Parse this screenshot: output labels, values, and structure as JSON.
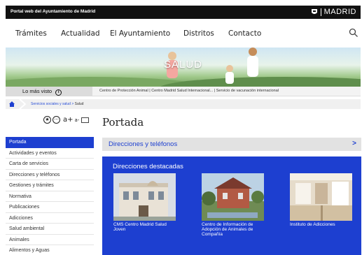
{
  "header": {
    "portal_label": "Portal web del Ayuntamiento de Madrid",
    "brand": "MADRID"
  },
  "nav": {
    "items": [
      "Trámites",
      "Actualidad",
      "El Ayuntamiento",
      "Distritos",
      "Contacto"
    ]
  },
  "hero": {
    "title": "SALUD"
  },
  "most_visited": {
    "label": "Lo más visto",
    "links": "Centro de Protección Animal  |  Centro Madrid Salud Internacional...  |  Servicio de vacunación internacional"
  },
  "breadcrumb": {
    "parent": "Servicios sociales y salud",
    "sep": ">",
    "current": "Salud"
  },
  "tools": {
    "a_plus": "a+",
    "a_minus": "a-"
  },
  "sidebar": {
    "items": [
      "Portada",
      "Actividades y eventos",
      "Carta de servicios",
      "Direcciones y teléfonos",
      "Gestiones y trámites",
      "Normativa",
      "Publicaciones",
      "Adicciones",
      "Salud ambiental",
      "Animales",
      "Alimentos y Aguas"
    ],
    "active_index": 0
  },
  "main": {
    "title": "Portada",
    "directory_bar": "Direcciones y teléfonos",
    "directory_chevron": ">",
    "featured_title": "Direcciones destacadas",
    "cards": [
      "CMS Centro Madrid Salud Joven",
      "Centro de Información de Adopción de Animales de Compañía",
      "Instituto de Adicciones"
    ]
  },
  "colors": {
    "accent": "#1d3fd0",
    "topbar": "#111111"
  }
}
